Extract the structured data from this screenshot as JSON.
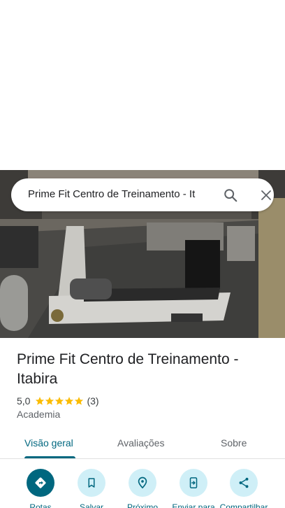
{
  "search": {
    "query": "Prime Fit Centro de Treinamento - It"
  },
  "place": {
    "name": "Prime Fit Centro de Treinamento - Itabira",
    "rating": "5,0",
    "stars": 5,
    "review_count": "(3)",
    "category": "Academia"
  },
  "tabs": [
    {
      "label": "Visão geral",
      "active": true
    },
    {
      "label": "Avaliações",
      "active": false
    },
    {
      "label": "Sobre",
      "active": false
    }
  ],
  "actions": [
    {
      "label": "Rotas",
      "icon": "directions-icon"
    },
    {
      "label": "Salvar",
      "icon": "bookmark-icon"
    },
    {
      "label": "Próximo",
      "icon": "nearby-icon"
    },
    {
      "label": "Enviar para",
      "icon": "send-to-phone-icon"
    },
    {
      "label": "Compartilhar",
      "icon": "share-icon"
    }
  ],
  "colors": {
    "accent": "#00677f",
    "accent_light": "#cfeff7",
    "star": "#fbbc04"
  }
}
